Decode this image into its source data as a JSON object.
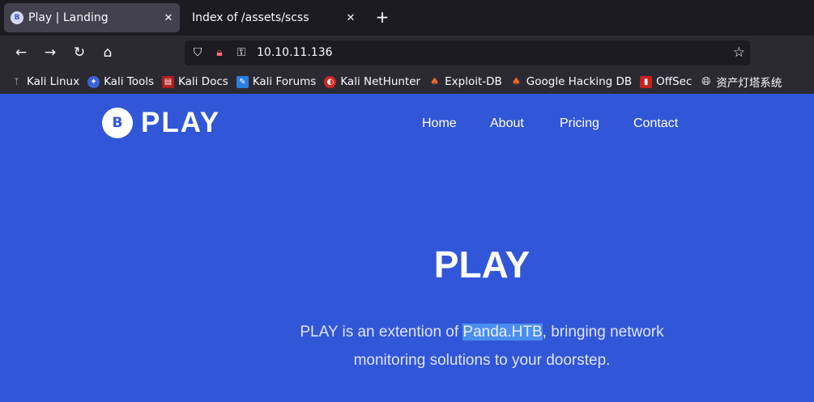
{
  "tabs": [
    {
      "title": "Play | Landing",
      "active": true,
      "favicon": "B"
    },
    {
      "title": "Index of /assets/scss",
      "active": false
    }
  ],
  "toolbar": {
    "url": "10.10.11.136"
  },
  "bookmarks": [
    {
      "label": "Kali Linux",
      "icon": "kali-dragon-icon"
    },
    {
      "label": "Kali Tools",
      "icon": "kali-tools-icon"
    },
    {
      "label": "Kali Docs",
      "icon": "kali-docs-icon"
    },
    {
      "label": "Kali Forums",
      "icon": "kali-forums-icon"
    },
    {
      "label": "Kali NetHunter",
      "icon": "kali-nethunter-icon"
    },
    {
      "label": "Exploit-DB",
      "icon": "exploit-db-icon"
    },
    {
      "label": "Google Hacking DB",
      "icon": "ghdb-icon"
    },
    {
      "label": "OffSec",
      "icon": "offsec-icon"
    },
    {
      "label": "资产灯塔系统",
      "icon": "globe-icon"
    }
  ],
  "site": {
    "logo_badge": "B",
    "logo_text": "PLAY",
    "nav": [
      "Home",
      "About",
      "Pricing",
      "Contact"
    ],
    "hero_title": "PLAY",
    "hero_text_before": "PLAY is an extention of ",
    "hero_text_highlight": "Panda.HTB",
    "hero_text_after": ", bringing network monitoring solutions to your doorstep."
  },
  "colors": {
    "page_background": "#3156d7",
    "browser_chrome": "#2b2a33",
    "highlight": "#4a8ef0"
  }
}
